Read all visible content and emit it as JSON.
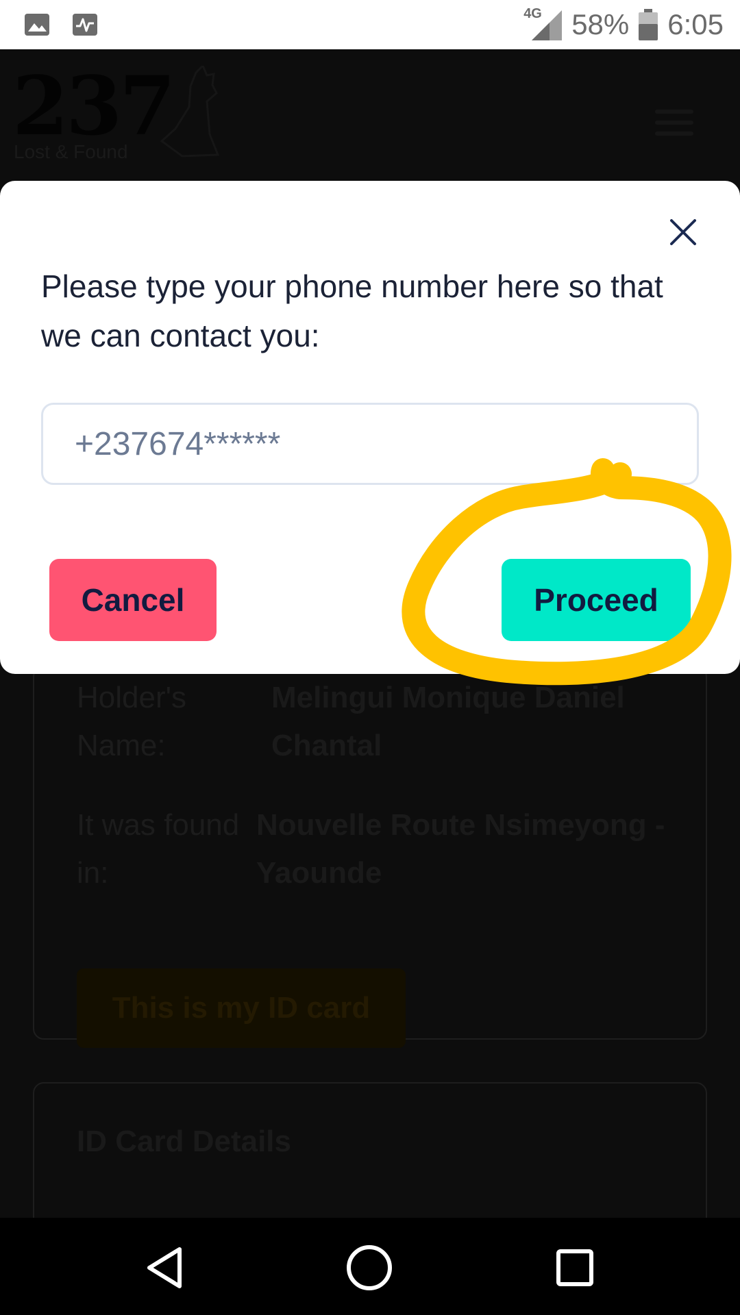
{
  "status_bar": {
    "left_icons": [
      "gallery-icon",
      "activity-icon"
    ],
    "network": "4G",
    "battery": "58%",
    "time": "6:05"
  },
  "background_page": {
    "logo_number": "237",
    "logo_subtitle": "Lost & Found",
    "card": {
      "holder_label": "Holder's Name:",
      "holder_value": "Melingui Monique Daniel Chantal",
      "found_label": "It was found in:",
      "found_value": "Nouvelle Route Nsimeyong - Yaounde",
      "claim_button": "This is my ID card"
    },
    "card2_text": "ID Card Details"
  },
  "modal": {
    "prompt": "Please type your phone number here so that we can contact you:",
    "phone_placeholder": "+237674******",
    "cancel_label": "Cancel",
    "proceed_label": "Proceed"
  },
  "colors": {
    "cancel": "#ff5472",
    "proceed": "#00e8c8",
    "annotation": "#ffc200",
    "text_dark": "#1b2236"
  },
  "nav_bar": {
    "icons": [
      "back-icon",
      "home-icon",
      "recents-icon"
    ]
  }
}
